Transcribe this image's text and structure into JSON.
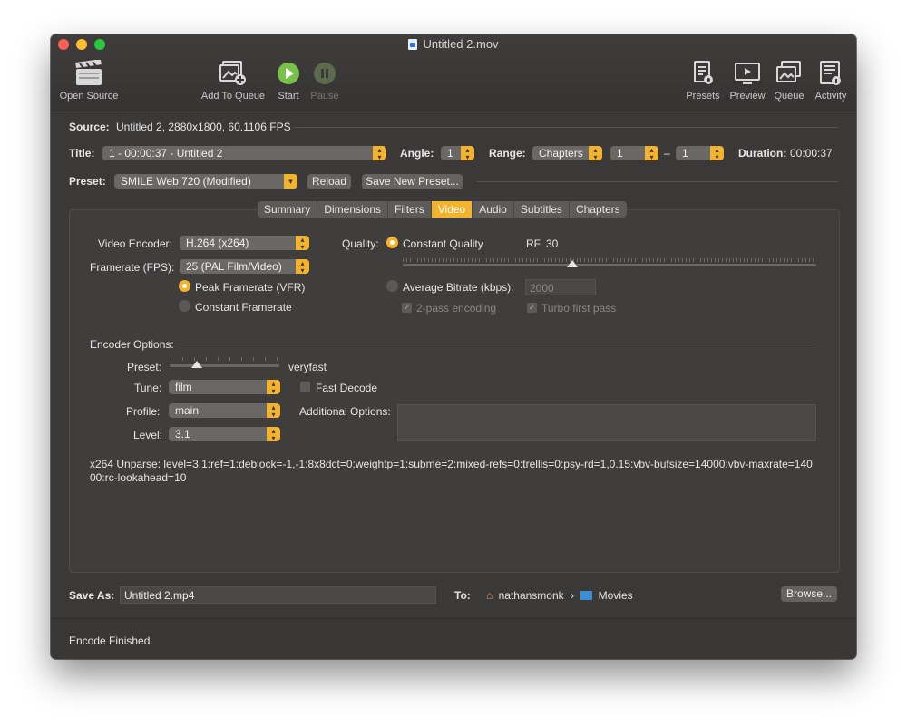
{
  "window": {
    "title": "Untitled 2.mov"
  },
  "colors": {
    "accent": "#f4b32e",
    "close": "#fd5f57",
    "minimize": "#febc2e",
    "zoom": "#28c840",
    "start_green": "#79c24a"
  },
  "toolbar": {
    "open_source": "Open Source",
    "add_to_queue": "Add To Queue",
    "start": "Start",
    "pause": "Pause",
    "presets": "Presets",
    "preview": "Preview",
    "queue": "Queue",
    "activity": "Activity"
  },
  "source": {
    "label": "Source:",
    "value": "Untitled 2, 2880x1800, 60.1106 FPS"
  },
  "title_row": {
    "title_label": "Title:",
    "title_value": "1 - 00:00:37 - Untitled 2",
    "angle_label": "Angle:",
    "angle_value": "1",
    "range_label": "Range:",
    "range_value": "Chapters",
    "range_start": "1",
    "range_sep": "–",
    "range_end": "1",
    "duration_label": "Duration:",
    "duration_value": "00:00:37"
  },
  "preset_row": {
    "label": "Preset:",
    "value": "SMILE Web 720 (Modified)",
    "reload": "Reload",
    "save_new": "Save New Preset..."
  },
  "tabs": [
    {
      "label": "Summary"
    },
    {
      "label": "Dimensions"
    },
    {
      "label": "Filters"
    },
    {
      "label": "Video"
    },
    {
      "label": "Audio"
    },
    {
      "label": "Subtitles"
    },
    {
      "label": "Chapters"
    }
  ],
  "video": {
    "encoder_label": "Video Encoder:",
    "encoder_value": "H.264 (x264)",
    "framerate_label": "Framerate (FPS):",
    "framerate_value": "25 (PAL Film/Video)",
    "peak": "Peak Framerate (VFR)",
    "constant": "Constant Framerate",
    "quality_label": "Quality:",
    "constant_quality": "Constant Quality",
    "rf_label": "RF",
    "rf_value": "30",
    "rf_slider_fraction": 0.41,
    "avg_bitrate": "Average Bitrate (kbps):",
    "bitrate_value": "2000",
    "two_pass": "2-pass encoding",
    "turbo": "Turbo first pass"
  },
  "encoder_options": {
    "heading": "Encoder Options:",
    "preset_label": "Preset:",
    "preset_value": "veryfast",
    "preset_slider_fraction": 0.25,
    "tune_label": "Tune:",
    "tune_value": "film",
    "fast_decode": "Fast Decode",
    "profile_label": "Profile:",
    "profile_value": "main",
    "additional_label": "Additional Options:",
    "level_label": "Level:",
    "level_value": "3.1",
    "unparse_line1": "x264 Unparse: level=3.1:ref=1:deblock=-1,-1:8x8dct=0:weightp=1:subme=2:mixed-refs=0:trellis=0:psy-rd=1,0.15:vbv-bufsize=14000:vbv-maxrate=140",
    "unparse_line2": "00:rc-lookahead=10"
  },
  "save": {
    "label": "Save As:",
    "value": "Untitled 2.mp4",
    "to_label": "To:",
    "user": "nathansmonk",
    "sep": "›",
    "folder": "Movies",
    "browse": "Browse..."
  },
  "status": "Encode Finished."
}
